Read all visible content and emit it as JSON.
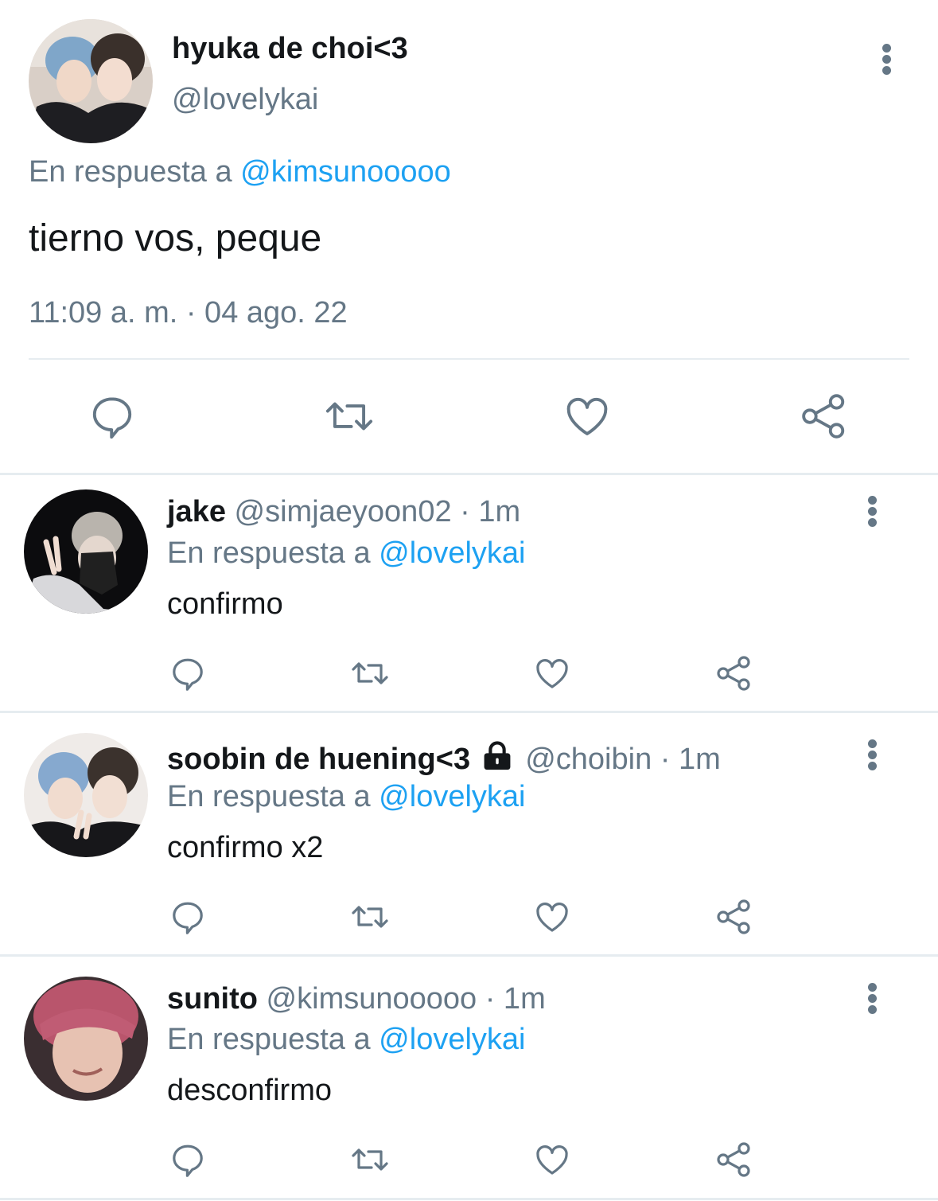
{
  "main_tweet": {
    "display_name": "hyuka de choi<3",
    "handle": "@lovelykai",
    "reply_prefix": "En respuesta a",
    "reply_to": "@kimsunooooo",
    "text": "tierno vos, peque",
    "timestamp": "11:09 a. m. · 04 ago. 22"
  },
  "replies": [
    {
      "display_name": "jake",
      "handle": "@simjaeyoon02",
      "time": "· 1m",
      "reply_prefix": "En respuesta a",
      "reply_to": "@lovelykai",
      "text": "confirmo",
      "locked": false
    },
    {
      "display_name": "soobin de huening<3",
      "handle": "@choibin",
      "time": "· 1m",
      "reply_prefix": "En respuesta a",
      "reply_to": "@lovelykai",
      "text": "confirmo x2",
      "locked": true
    },
    {
      "display_name": "sunito",
      "handle": "@kimsunooooo",
      "time": "· 1m",
      "reply_prefix": "En respuesta a",
      "reply_to": "@lovelykai",
      "text": "desconfirmo",
      "locked": false
    }
  ],
  "icons": [
    "reply-icon",
    "retweet-icon",
    "like-icon",
    "share-icon",
    "more-options-icon",
    "lock-icon"
  ],
  "colors": {
    "link": "#1da1f2",
    "muted": "#657786",
    "text": "#14171a",
    "divider": "#e6ecf0"
  }
}
